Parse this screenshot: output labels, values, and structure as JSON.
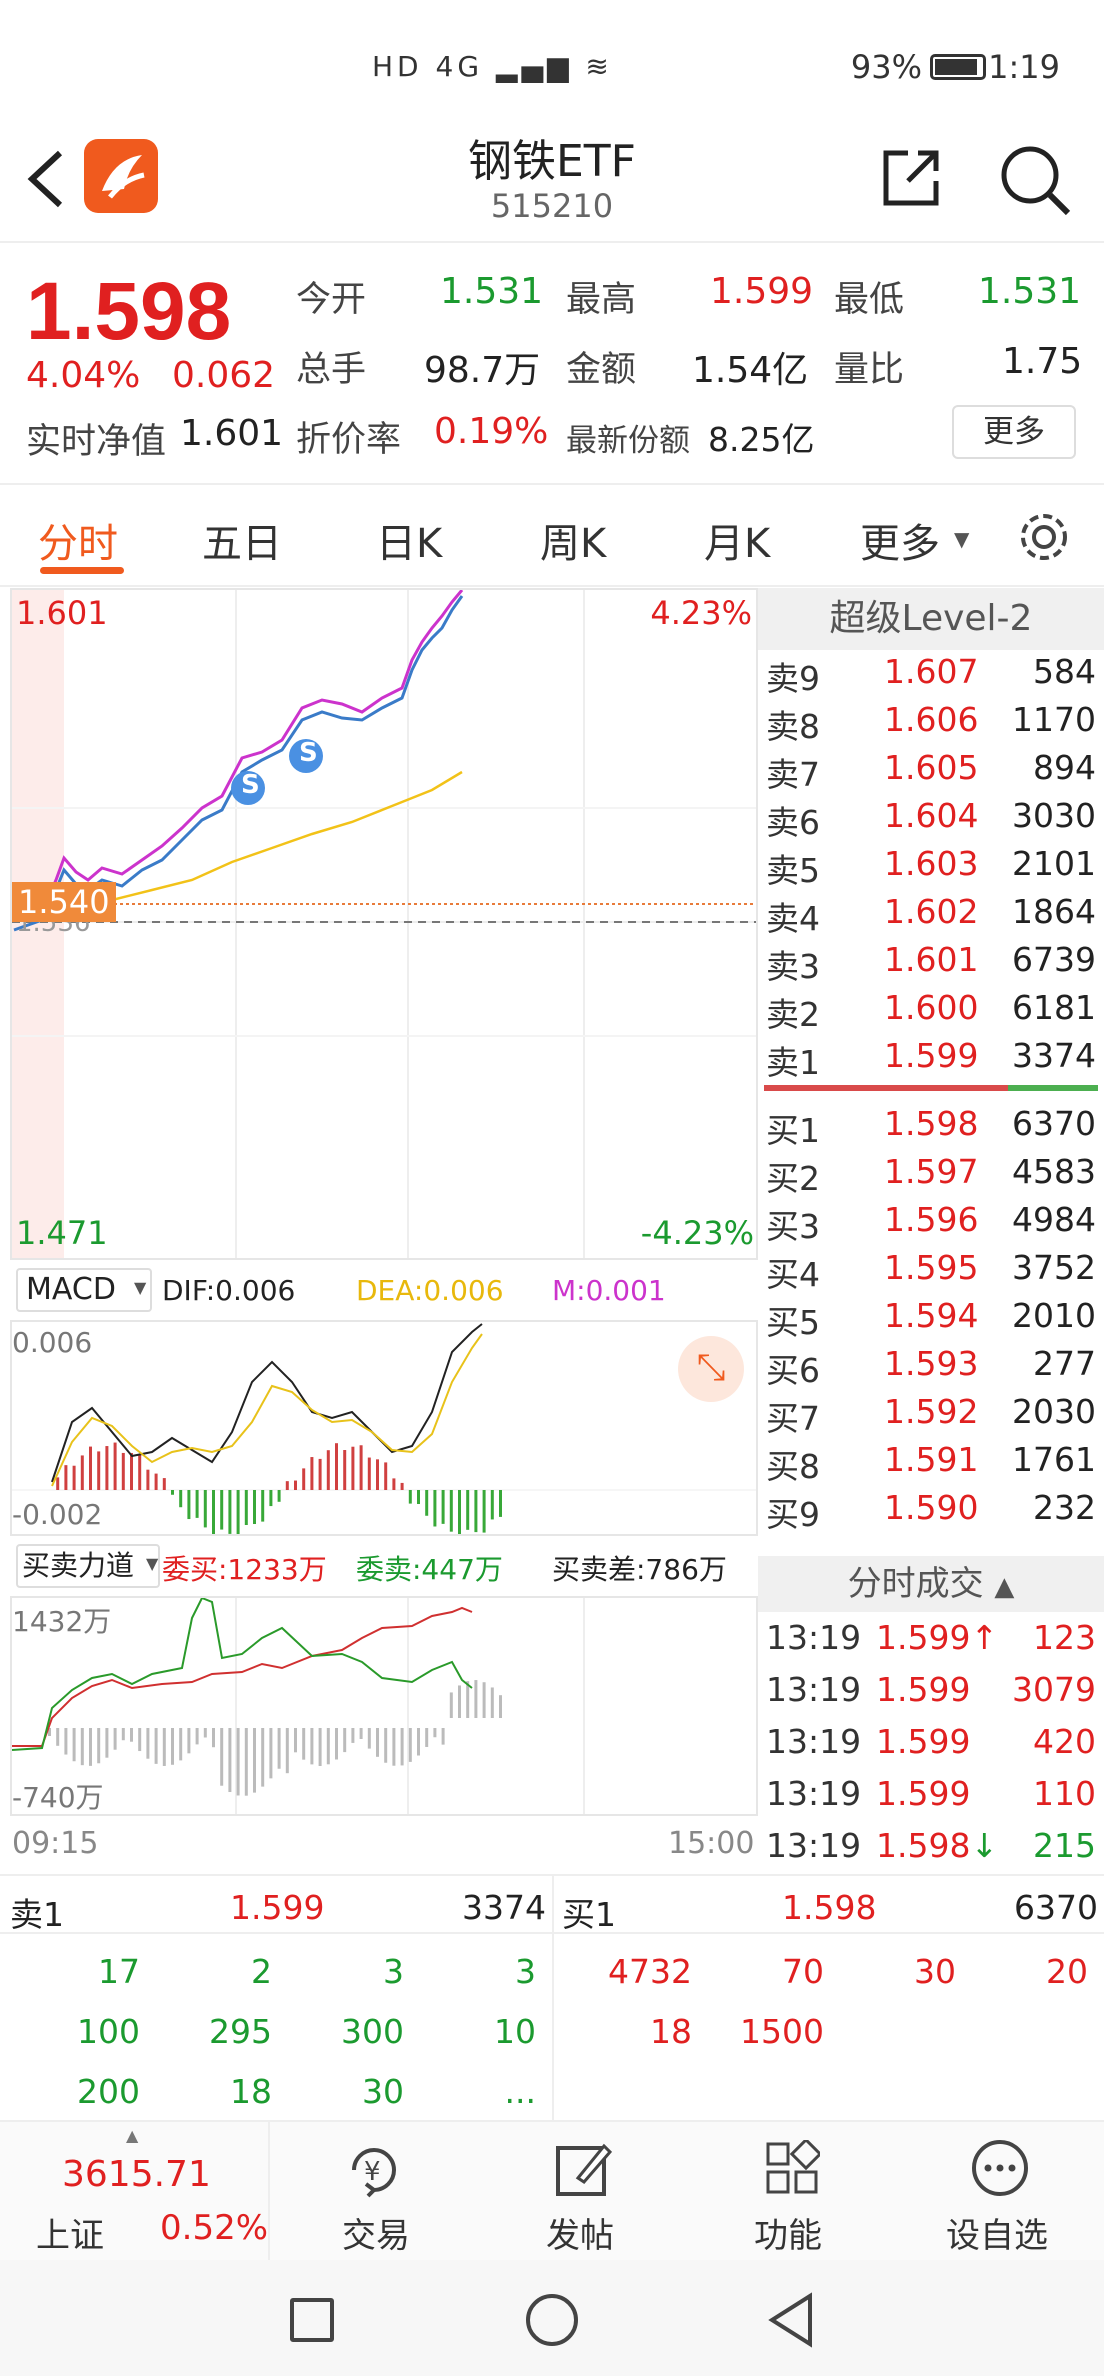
{
  "status_bar": {
    "time": "1:19",
    "battery": "93%",
    "indicators": "HD 4G ▂▄▆ ≋"
  },
  "header": {
    "title": "钢铁ETF",
    "code": "515210"
  },
  "quote": {
    "price": "1.598",
    "change_pct": "4.04%",
    "change": "0.062",
    "nav_label": "实时净值",
    "nav": "1.601",
    "open_label": "今开",
    "open": "1.531",
    "high_label": "最高",
    "high": "1.599",
    "low_label": "最低",
    "low": "1.531",
    "volume_label": "总手",
    "volume": "98.7万",
    "amount_label": "金额",
    "amount": "1.54亿",
    "ratio_label": "量比",
    "ratio": "1.75",
    "discount_label": "折价率",
    "discount": "0.19%",
    "shares_label": "最新份额",
    "shares": "8.25亿",
    "more_button": "更多"
  },
  "tabs": [
    "分时",
    "五日",
    "日K",
    "周K",
    "月K",
    "更多"
  ],
  "chart": {
    "top_price": "1.601",
    "top_pct": "4.23%",
    "bottom_price": "1.471",
    "bottom_pct": "-4.23%",
    "ref_price": "1.540",
    "ref_price_under": "1.536",
    "marker": "S"
  },
  "macd": {
    "label": "MACD",
    "dif": "DIF:0.006",
    "dea": "DEA:0.006",
    "m": "M:0.001",
    "top": "0.006",
    "bottom": "-0.002"
  },
  "flow": {
    "label": "买卖力道",
    "buy": "委买:1233万",
    "sell": "委卖:447万",
    "diff": "买卖差:786万",
    "top": "1432万",
    "bottom": "-740万"
  },
  "time_axis": {
    "start": "09:15",
    "end": "15:00"
  },
  "level2": {
    "title": "超级Level-2",
    "asks": [
      {
        "n": "卖9",
        "p": "1.607",
        "v": "584"
      },
      {
        "n": "卖8",
        "p": "1.606",
        "v": "1170"
      },
      {
        "n": "卖7",
        "p": "1.605",
        "v": "894"
      },
      {
        "n": "卖6",
        "p": "1.604",
        "v": "3030"
      },
      {
        "n": "卖5",
        "p": "1.603",
        "v": "2101"
      },
      {
        "n": "卖4",
        "p": "1.602",
        "v": "1864"
      },
      {
        "n": "卖3",
        "p": "1.601",
        "v": "6739"
      },
      {
        "n": "卖2",
        "p": "1.600",
        "v": "6181"
      },
      {
        "n": "卖1",
        "p": "1.599",
        "v": "3374"
      }
    ],
    "bids": [
      {
        "n": "买1",
        "p": "1.598",
        "v": "6370"
      },
      {
        "n": "买2",
        "p": "1.597",
        "v": "4583"
      },
      {
        "n": "买3",
        "p": "1.596",
        "v": "4984"
      },
      {
        "n": "买4",
        "p": "1.595",
        "v": "3752"
      },
      {
        "n": "买5",
        "p": "1.594",
        "v": "2010"
      },
      {
        "n": "买6",
        "p": "1.593",
        "v": "277"
      },
      {
        "n": "买7",
        "p": "1.592",
        "v": "2030"
      },
      {
        "n": "买8",
        "p": "1.591",
        "v": "1761"
      },
      {
        "n": "买9",
        "p": "1.590",
        "v": "232"
      }
    ],
    "trades_title": "分时成交",
    "trades": [
      {
        "t": "13:19",
        "p": "1.599↑",
        "v": "123"
      },
      {
        "t": "13:19",
        "p": "1.599",
        "v": "3079"
      },
      {
        "t": "13:19",
        "p": "1.599",
        "v": "420"
      },
      {
        "t": "13:19",
        "p": "1.599",
        "v": "110"
      },
      {
        "t": "13:19",
        "p": "1.598↓",
        "v": "215"
      }
    ]
  },
  "queues": {
    "sell_label": "卖1",
    "sell_price": "1.599",
    "sell_vol": "3374",
    "buy_label": "买1",
    "buy_price": "1.598",
    "buy_vol": "6370",
    "sell_rows": [
      [
        "17",
        "2",
        "3",
        "3"
      ],
      [
        "100",
        "295",
        "300",
        "10"
      ],
      [
        "200",
        "18",
        "30",
        "..."
      ]
    ],
    "buy_rows": [
      [
        "4732",
        "70",
        "30",
        "20"
      ],
      [
        "18",
        "1500",
        "",
        ""
      ]
    ]
  },
  "bottom": {
    "index_value": "3615.71",
    "index_name": "上证",
    "index_pct": "0.52%",
    "trade": "交易",
    "post": "发帖",
    "func": "功能",
    "fav": "设自选"
  }
}
